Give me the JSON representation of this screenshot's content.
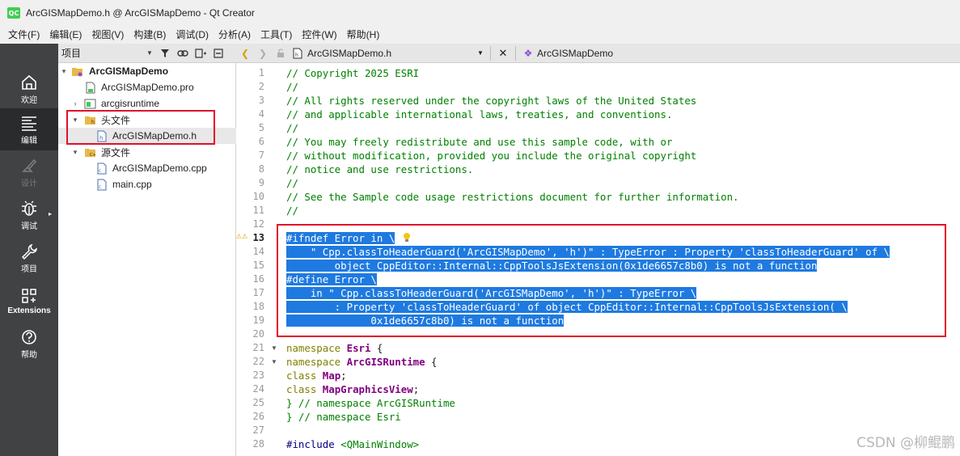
{
  "window": {
    "title": "ArcGISMapDemo.h @ ArcGISMapDemo - Qt Creator",
    "logo_text": "QC"
  },
  "menu": [
    "文件(F)",
    "编辑(E)",
    "视图(V)",
    "构建(B)",
    "调试(D)",
    "分析(A)",
    "工具(T)",
    "控件(W)",
    "帮助(H)"
  ],
  "modes": [
    {
      "label": "欢迎",
      "icon": "home-icon"
    },
    {
      "label": "编辑",
      "icon": "edit-icon"
    },
    {
      "label": "设计",
      "icon": "design-icon"
    },
    {
      "label": "调试",
      "icon": "bug-icon"
    },
    {
      "label": "项目",
      "icon": "wrench-icon"
    },
    {
      "label": "Extensions",
      "icon": "extensions-icon"
    },
    {
      "label": "帮助",
      "icon": "help-icon"
    }
  ],
  "project_pane": {
    "selector_label": "项目",
    "tree": [
      {
        "label": "ArcGISMapDemo",
        "bold": true
      },
      {
        "label": "ArcGISMapDemo.pro"
      },
      {
        "label": "arcgisruntime"
      },
      {
        "label": "头文件"
      },
      {
        "label": "ArcGISMapDemo.h"
      },
      {
        "label": "源文件"
      },
      {
        "label": "ArcGISMapDemo.cpp"
      },
      {
        "label": "main.cpp"
      }
    ]
  },
  "editor_toolbar": {
    "file": "ArcGISMapDemo.h",
    "scope": "ArcGISMapDemo"
  },
  "code_lines": [
    "// Copyright 2025 ESRI",
    "//",
    "// All rights reserved under the copyright laws of the United States",
    "// and applicable international laws, treaties, and conventions.",
    "//",
    "// You may freely redistribute and use this sample code, with or",
    "// without modification, provided you include the original copyright",
    "// notice and use restrictions.",
    "//",
    "// See the Sample code usage restrictions document for further information.",
    "//",
    "",
    "#ifndef Error in \\",
    "    \" Cpp.classToHeaderGuard('ArcGISMapDemo', 'h')\" : TypeError : Property 'classToHeaderGuard' of \\",
    "        object CppEditor::Internal::CppToolsJsExtension(0x1de6657c8b0) is not a function",
    "#define Error \\",
    "    in \" Cpp.classToHeaderGuard('ArcGISMapDemo', 'h')\" : TypeError \\",
    "        : Property 'classToHeaderGuard' of object CppEditor::Internal::CppToolsJsExtension( \\",
    "              0x1de6657c8b0) is not a function",
    "",
    "namespace Esri {",
    "namespace ArcGISRuntime {",
    "class Map;",
    "class MapGraphicsView;",
    "} // namespace ArcGISRuntime",
    "} // namespace Esri",
    "",
    "#include <QMainWindow>"
  ],
  "code_tokens": {
    "ns_kw": "namespace",
    "class_kw": "class",
    "include_kw": "#include",
    "ns_esri": "Esri",
    "ns_runtime": "ArcGISRuntime",
    "cls_map": "Map",
    "cls_view": "MapGraphicsView",
    "brace_open": " {",
    "semicolon": ";",
    "close_runtime": "} // namespace ArcGISRuntime",
    "close_esri": "} // namespace Esri",
    "include_target": " <QMainWindow>"
  },
  "line_numbers": [
    "1",
    "2",
    "3",
    "4",
    "5",
    "6",
    "7",
    "8",
    "9",
    "10",
    "11",
    "12",
    "13",
    "14",
    "15",
    "16",
    "17",
    "18",
    "19",
    "20",
    "21",
    "22",
    "23",
    "24",
    "25",
    "26",
    "27",
    "28"
  ],
  "current_line": "13",
  "watermark": "CSDN @柳鲲鹏",
  "colors": {
    "selection": "#1e7ae0",
    "comment": "#008000",
    "keyword": "#808000",
    "type": "#800080",
    "annotation_box": "#e0102a",
    "sidebar": "#404244"
  }
}
